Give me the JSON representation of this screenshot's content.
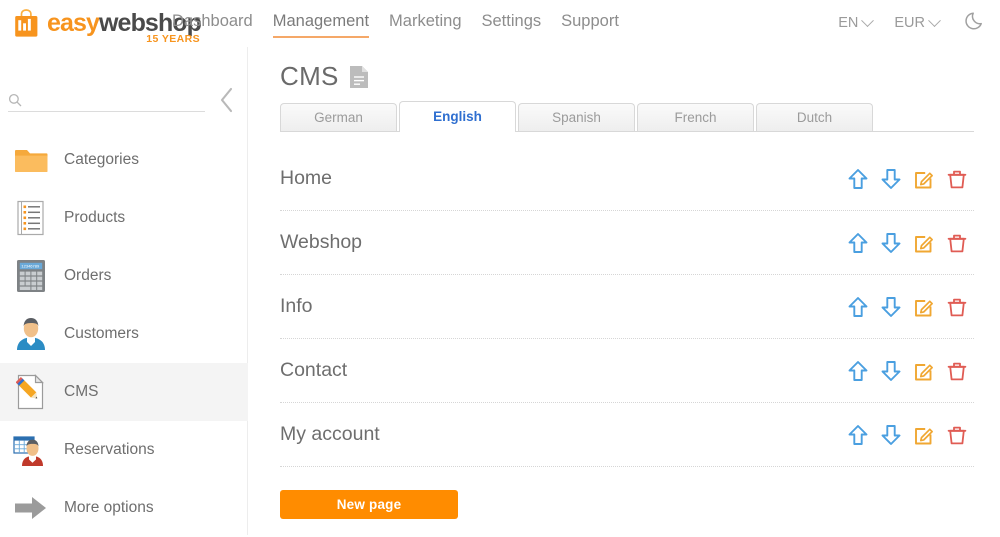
{
  "brand": {
    "name_part1": "easy",
    "name_part2": "webshop",
    "tagline": "15 YEARS",
    "logo_icon": "shopping-bag-chart-icon",
    "color_orange": "#f7941e",
    "color_dark": "#4a4a4a"
  },
  "topnav": {
    "items": [
      {
        "label": "Dashboard",
        "active": false
      },
      {
        "label": "Management",
        "active": true
      },
      {
        "label": "Marketing",
        "active": false
      },
      {
        "label": "Settings",
        "active": false
      },
      {
        "label": "Support",
        "active": false
      }
    ],
    "active_underline_color": "#f5a868"
  },
  "topright": {
    "language": "EN",
    "currency": "EUR",
    "theme_toggle_icon": "moon-icon"
  },
  "sidebar": {
    "search": {
      "value": "",
      "placeholder": "",
      "icon": "search-icon"
    },
    "collapse_icon": "chevron-left-icon",
    "items": [
      {
        "label": "Categories",
        "icon": "folder-icon",
        "active": false
      },
      {
        "label": "Products",
        "icon": "list-page-icon",
        "active": false
      },
      {
        "label": "Orders",
        "icon": "calculator-icon",
        "active": false
      },
      {
        "label": "Customers",
        "icon": "person-blue-icon",
        "active": false
      },
      {
        "label": "CMS",
        "icon": "page-pencil-icon",
        "active": true
      },
      {
        "label": "Reservations",
        "icon": "calendar-person-icon",
        "active": false
      },
      {
        "label": "More options",
        "icon": "arrow-right-icon",
        "active": false
      }
    ]
  },
  "main": {
    "title": "CMS",
    "title_icon": "document-icon",
    "tabs": [
      {
        "label": "German",
        "active": false
      },
      {
        "label": "English",
        "active": true
      },
      {
        "label": "Spanish",
        "active": false
      },
      {
        "label": "French",
        "active": false
      },
      {
        "label": "Dutch",
        "active": false
      }
    ],
    "active_tab_color": "#2f6fd0",
    "pages": [
      {
        "name": "Home"
      },
      {
        "name": "Webshop"
      },
      {
        "name": "Info"
      },
      {
        "name": "Contact"
      },
      {
        "name": "My account"
      }
    ],
    "row_actions": [
      {
        "name": "move-up",
        "icon": "arrow-up-icon",
        "color": "#4a9fe0"
      },
      {
        "name": "move-down",
        "icon": "arrow-down-icon",
        "color": "#4a9fe0"
      },
      {
        "name": "edit",
        "icon": "edit-pencil-icon",
        "color": "#f0a732"
      },
      {
        "name": "delete",
        "icon": "trash-icon",
        "color": "#e05c54"
      }
    ],
    "new_page_button": "New page",
    "new_page_button_color": "#ff8c00"
  }
}
